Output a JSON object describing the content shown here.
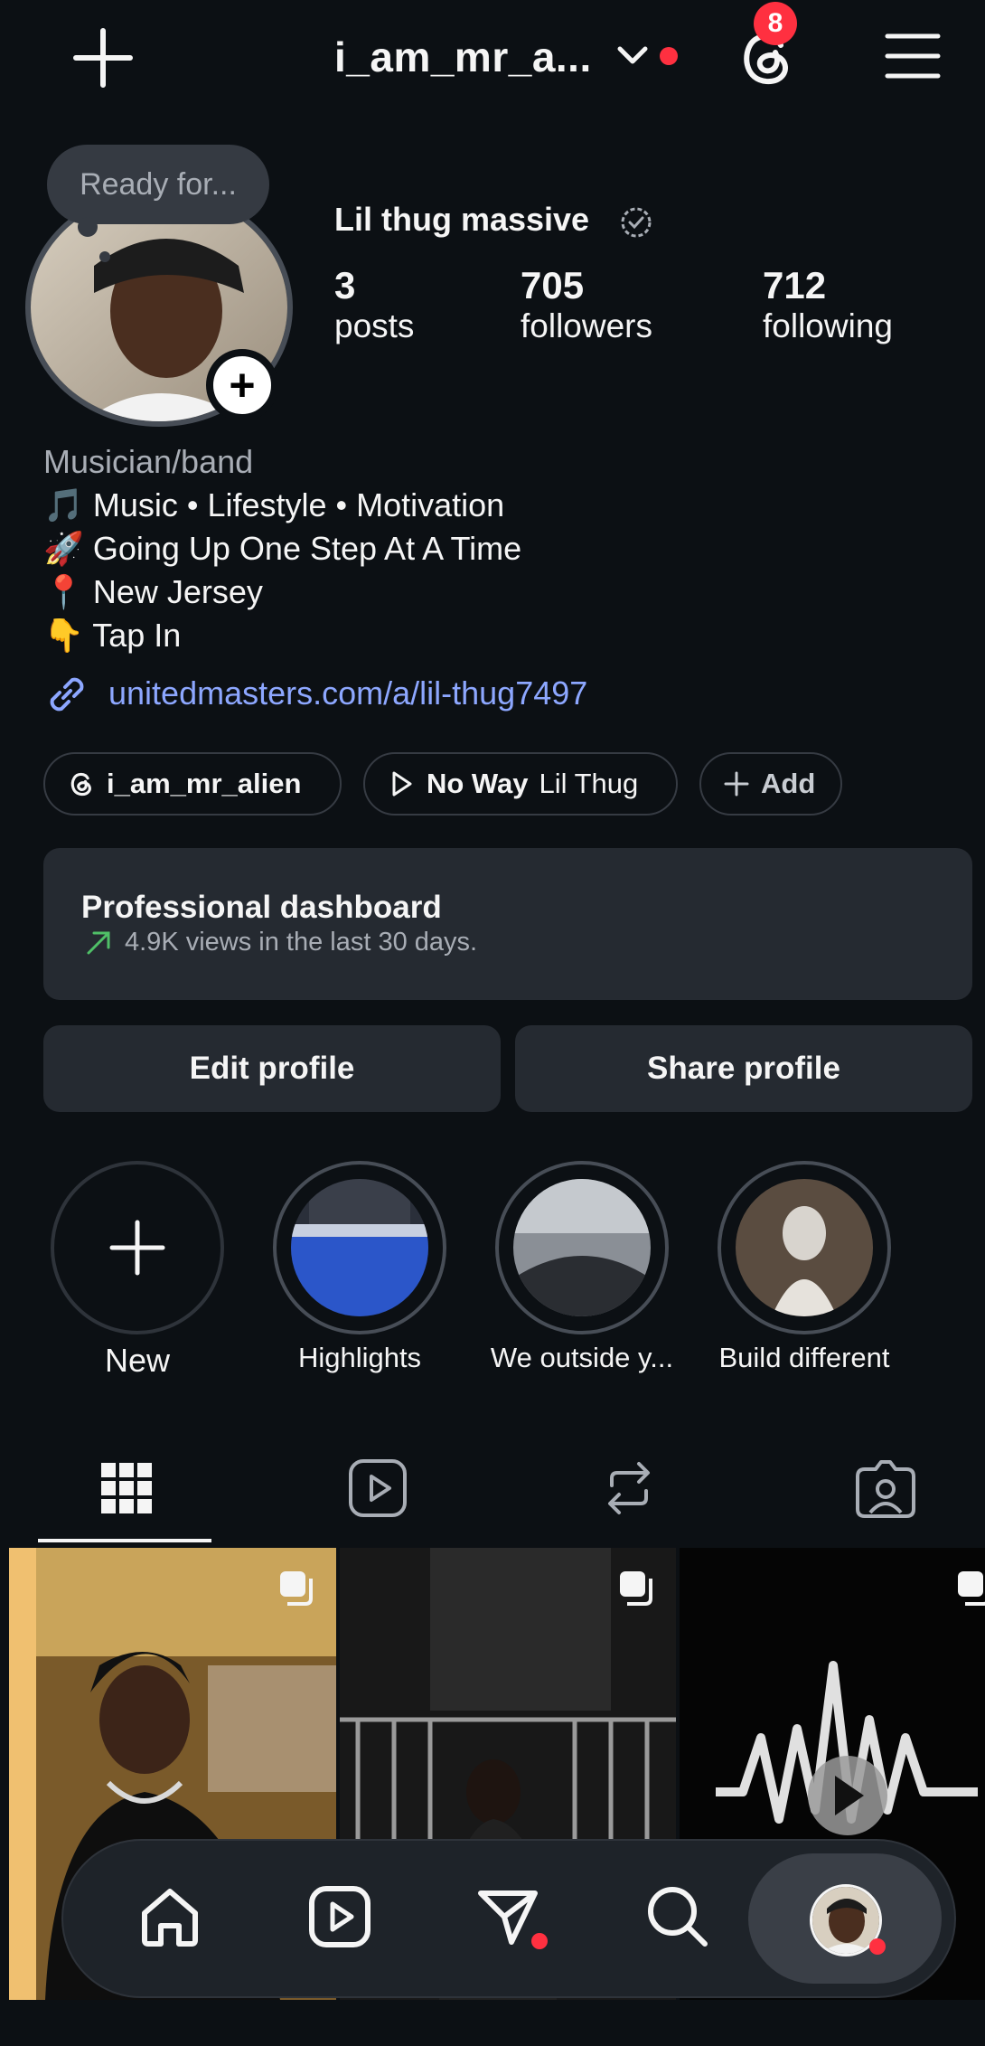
{
  "header": {
    "username": "i_am_mr_a...",
    "threads_badge_count": "8",
    "icons": [
      "plus-icon",
      "chevron-down-icon",
      "threads-icon",
      "menu-icon"
    ]
  },
  "profile": {
    "note": "Ready for...",
    "name": "Lil thug massive",
    "stats": [
      {
        "value": "3",
        "label": "posts"
      },
      {
        "value": "705",
        "label": "followers"
      },
      {
        "value": "712",
        "label": "following"
      }
    ],
    "category": "Musician/band",
    "bio_lines": [
      {
        "emoji": "🎵",
        "text": "Music • Lifestyle • Motivation"
      },
      {
        "emoji": "🚀",
        "text": "Going Up One Step At A Time"
      },
      {
        "emoji": "📍",
        "text": "New Jersey"
      },
      {
        "emoji": "👇",
        "text": "Tap In"
      }
    ],
    "link": "unitedmasters.com/a/lil-thug7497"
  },
  "chips": {
    "threads": "i_am_mr_alien",
    "music_title": "No Way",
    "music_artist": "Lil Thug",
    "add": "Add"
  },
  "dashboard": {
    "title": "Professional dashboard",
    "subtitle": "4.9K views in the last 30 days."
  },
  "buttons": {
    "edit": "Edit profile",
    "share": "Share profile"
  },
  "highlights": [
    {
      "label": "New"
    },
    {
      "label": "Highlights"
    },
    {
      "label": "We outside y..."
    },
    {
      "label": "Build different"
    }
  ],
  "tabs": [
    "grid-icon",
    "reels-icon",
    "reposts-icon",
    "tagged-icon"
  ],
  "colors": {
    "background": "#0c1014",
    "link": "#8da7ff",
    "notification": "#ff3040",
    "trend": "#4fbf67"
  }
}
